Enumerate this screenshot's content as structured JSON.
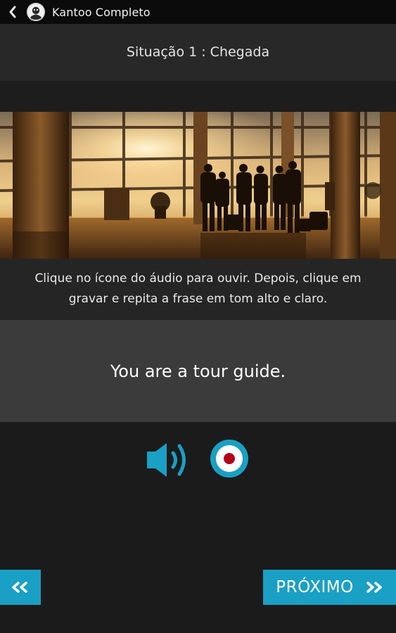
{
  "app": {
    "title": "Kantoo Completo",
    "back_icon": "chevron-left-icon",
    "logo_icon": "kantoo-logo-icon"
  },
  "situation": {
    "title": "Situação 1 : Chegada"
  },
  "photo": {
    "subject": "airport-terminal-photo"
  },
  "instruction": {
    "text": "Clique no ícone do áudio para ouvir. Depois, clique em gravar e repita a frase em tom alto e claro."
  },
  "phrase": {
    "text": "You are a tour guide."
  },
  "controls": {
    "audio_icon": "speaker-icon",
    "record_icon": "record-icon",
    "accent_color": "#1aa0c4",
    "record_color": "#b3001b"
  },
  "navigation": {
    "next_label": "PRÓXIMO",
    "prev_icon": "double-chevron-left-icon",
    "next_icon": "double-chevron-right-icon"
  }
}
